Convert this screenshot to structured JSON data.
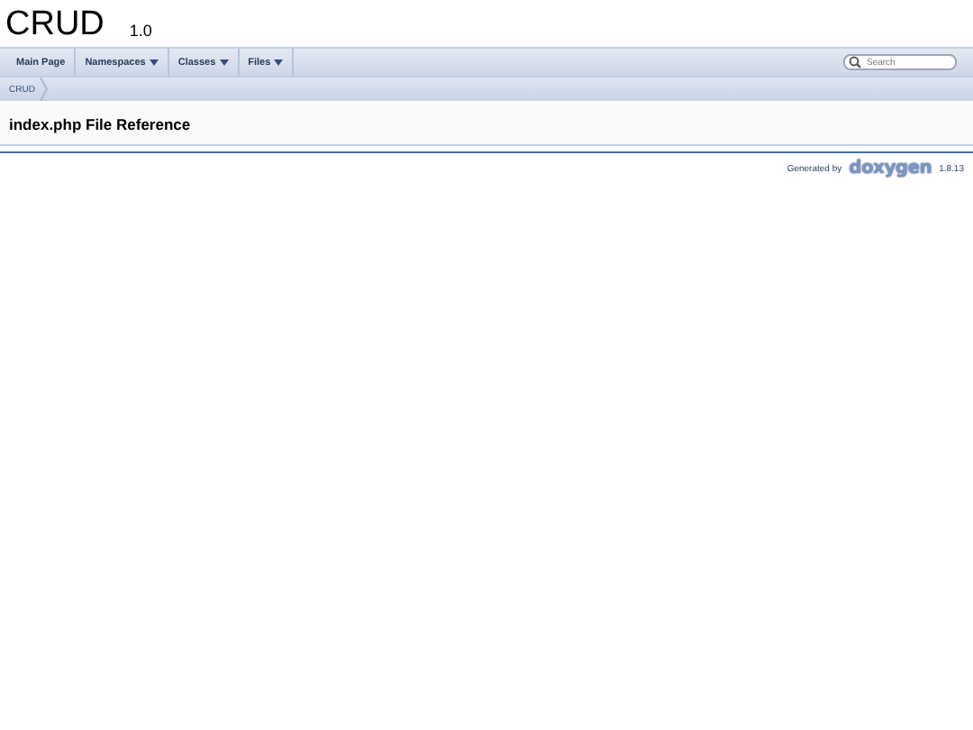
{
  "project": {
    "name": "CRUD",
    "version": "1.0"
  },
  "menu": [
    {
      "label": "Main Page",
      "has_submenu": false
    },
    {
      "label": "Namespaces",
      "has_submenu": true
    },
    {
      "label": "Classes",
      "has_submenu": true
    },
    {
      "label": "Files",
      "has_submenu": true
    }
  ],
  "search": {
    "placeholder": "Search"
  },
  "breadcrumb": [
    "CRUD"
  ],
  "heading": "index.php File Reference",
  "footer": {
    "generated_by": "Generated by",
    "logo": "doxygen",
    "version": "1.8.13"
  }
}
